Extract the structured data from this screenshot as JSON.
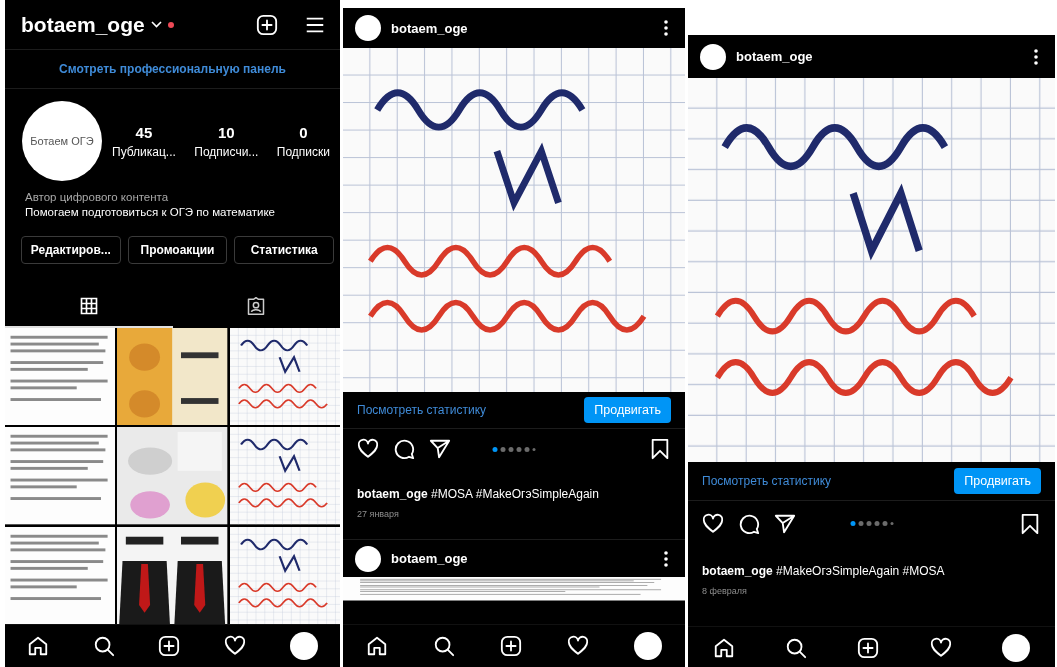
{
  "profile_screen": {
    "username": "botaem_oge",
    "dashboard_link": "Смотреть профессиональную панель",
    "avatar_text": "Ботаем ОГЭ",
    "stats": [
      {
        "value": "45",
        "label": "Публикац..."
      },
      {
        "value": "10",
        "label": "Подписчи..."
      },
      {
        "value": "0",
        "label": "Подписки"
      }
    ],
    "bio": {
      "category": "Автор цифрового контента",
      "text": "Помогаем подготовиться к ОГЭ по математике"
    },
    "buttons": [
      "Редактиров...",
      "Промоакции",
      "Статистика"
    ],
    "tabs": [
      {
        "kind": "grid",
        "selected": true
      },
      {
        "kind": "tagged",
        "selected": false
      }
    ],
    "nav": [
      {
        "kind": "home"
      },
      {
        "kind": "search"
      },
      {
        "kind": "add"
      },
      {
        "kind": "heart"
      },
      {
        "kind": "avatar"
      }
    ]
  },
  "feed_screens": [
    {
      "posts": [
        {
          "username": "botaem_oge",
          "stats_link": "Посмотреть статистику",
          "promote_button": "Продвигать",
          "carousel": [
            {
              "selected": true
            },
            {
              "selected": false
            },
            {
              "selected": false
            },
            {
              "selected": false
            },
            {
              "selected": false
            },
            {
              "selected": false
            }
          ],
          "caption": {
            "username": "botaem_oge",
            "text": "#MOSA #MakeOгэSimpleAgain"
          },
          "date": "27 января"
        },
        {
          "username": "botaem_oge"
        }
      ],
      "nav": [
        {
          "kind": "home"
        },
        {
          "kind": "search"
        },
        {
          "kind": "add"
        },
        {
          "kind": "heart"
        },
        {
          "kind": "avatar"
        }
      ]
    },
    {
      "posts": [
        {
          "username": "botaem_oge",
          "stats_link": "Посмотреть статистику",
          "promote_button": "Продвигать",
          "carousel": [
            {
              "selected": true
            },
            {
              "selected": false
            },
            {
              "selected": false
            },
            {
              "selected": false
            },
            {
              "selected": false
            },
            {
              "selected": false
            }
          ],
          "caption": {
            "username": "botaem_oge",
            "text": "#MakeOгэSimpleAgain #MOSA"
          },
          "date": "8 февраля"
        }
      ],
      "nav": [
        {
          "kind": "home"
        },
        {
          "kind": "search"
        },
        {
          "kind": "add"
        },
        {
          "kind": "heart"
        },
        {
          "kind": "avatar"
        }
      ]
    }
  ]
}
